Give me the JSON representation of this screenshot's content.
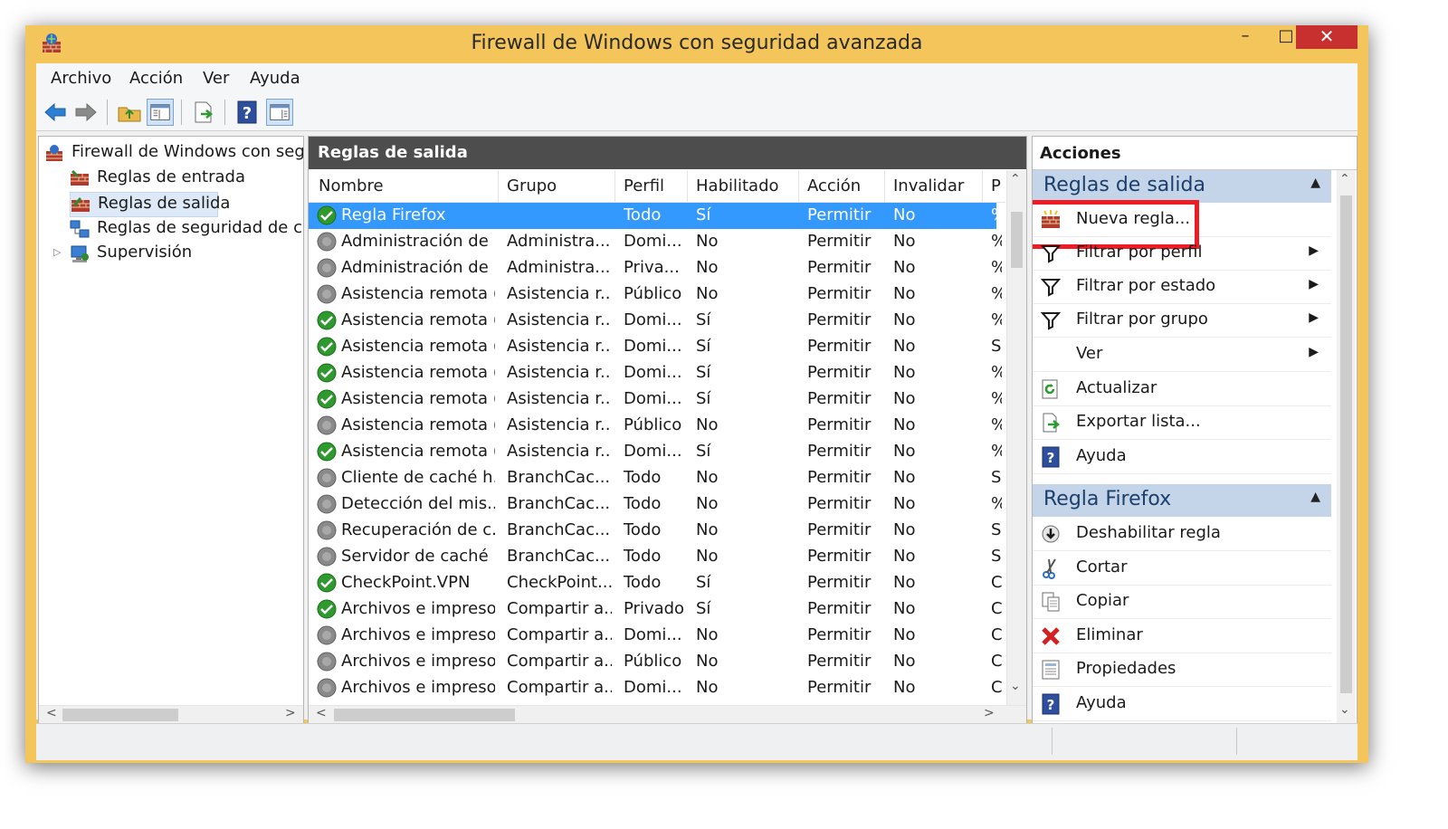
{
  "window": {
    "title": "Firewall de Windows con seguridad avanzada",
    "min": "–",
    "max": "□",
    "close": "✕"
  },
  "menu": [
    "Archivo",
    "Acción",
    "Ver",
    "Ayuda"
  ],
  "toolbar_icons": [
    "back-arrow-icon",
    "forward-arrow-icon",
    "up-folder-icon",
    "show-hide-console-tree-icon",
    "export-list-icon",
    "help-icon",
    "show-hide-action-pane-icon"
  ],
  "tree": [
    {
      "label": "Firewall de Windows con segur",
      "icon": "firewall-icon"
    },
    {
      "label": "Reglas de entrada",
      "icon": "inbound-rules-icon"
    },
    {
      "label": "Reglas de salida",
      "icon": "outbound-rules-icon",
      "selected": true
    },
    {
      "label": "Reglas de seguridad de con",
      "icon": "connection-security-icon"
    },
    {
      "label": "Supervisión",
      "icon": "monitoring-icon",
      "collapsed": true
    }
  ],
  "center": {
    "title": "Reglas de salida",
    "columns": [
      "Nombre",
      "Grupo",
      "Perfil",
      "Habilitado",
      "Acción",
      "Invalidar",
      "P"
    ],
    "rows": [
      {
        "nombre": "Regla Firefox",
        "grupo": "",
        "perfil": "Todo",
        "habilitado": "Sí",
        "accion": "Permitir",
        "invalidar": "No",
        "p": "%",
        "enabled": true,
        "selected": true
      },
      {
        "nombre": "Administración de ...",
        "grupo": "Administra...",
        "perfil": "Domi...",
        "habilitado": "No",
        "accion": "Permitir",
        "invalidar": "No",
        "p": "%",
        "enabled": false
      },
      {
        "nombre": "Administración de ...",
        "grupo": "Administra...",
        "perfil": "Priva...",
        "habilitado": "No",
        "accion": "Permitir",
        "invalidar": "No",
        "p": "%",
        "enabled": false
      },
      {
        "nombre": "Asistencia remota (...",
        "grupo": "Asistencia r...",
        "perfil": "Público",
        "habilitado": "No",
        "accion": "Permitir",
        "invalidar": "No",
        "p": "%",
        "enabled": false
      },
      {
        "nombre": "Asistencia remota (...",
        "grupo": "Asistencia r...",
        "perfil": "Domi...",
        "habilitado": "Sí",
        "accion": "Permitir",
        "invalidar": "No",
        "p": "%",
        "enabled": true
      },
      {
        "nombre": "Asistencia remota (...",
        "grupo": "Asistencia r...",
        "perfil": "Domi...",
        "habilitado": "Sí",
        "accion": "Permitir",
        "invalidar": "No",
        "p": "S",
        "enabled": true
      },
      {
        "nombre": "Asistencia remota (...",
        "grupo": "Asistencia r...",
        "perfil": "Domi...",
        "habilitado": "Sí",
        "accion": "Permitir",
        "invalidar": "No",
        "p": "%",
        "enabled": true
      },
      {
        "nombre": "Asistencia remota (...",
        "grupo": "Asistencia r...",
        "perfil": "Domi...",
        "habilitado": "Sí",
        "accion": "Permitir",
        "invalidar": "No",
        "p": "%",
        "enabled": true
      },
      {
        "nombre": "Asistencia remota (...",
        "grupo": "Asistencia r...",
        "perfil": "Público",
        "habilitado": "No",
        "accion": "Permitir",
        "invalidar": "No",
        "p": "%",
        "enabled": false
      },
      {
        "nombre": "Asistencia remota (...",
        "grupo": "Asistencia r...",
        "perfil": "Domi...",
        "habilitado": "Sí",
        "accion": "Permitir",
        "invalidar": "No",
        "p": "%",
        "enabled": true
      },
      {
        "nombre": "Cliente de caché h...",
        "grupo": "BranchCac...",
        "perfil": "Todo",
        "habilitado": "No",
        "accion": "Permitir",
        "invalidar": "No",
        "p": "S",
        "enabled": false
      },
      {
        "nombre": "Detección del mis...",
        "grupo": "BranchCac...",
        "perfil": "Todo",
        "habilitado": "No",
        "accion": "Permitir",
        "invalidar": "No",
        "p": "%",
        "enabled": false
      },
      {
        "nombre": "Recuperación de c...",
        "grupo": "BranchCac...",
        "perfil": "Todo",
        "habilitado": "No",
        "accion": "Permitir",
        "invalidar": "No",
        "p": "S",
        "enabled": false
      },
      {
        "nombre": "Servidor de caché ...",
        "grupo": "BranchCac...",
        "perfil": "Todo",
        "habilitado": "No",
        "accion": "Permitir",
        "invalidar": "No",
        "p": "S",
        "enabled": false
      },
      {
        "nombre": "CheckPoint.VPN",
        "grupo": "CheckPoint...",
        "perfil": "Todo",
        "habilitado": "Sí",
        "accion": "Permitir",
        "invalidar": "No",
        "p": "C",
        "enabled": true
      },
      {
        "nombre": "Archivos e impreso...",
        "grupo": "Compartir a...",
        "perfil": "Privado",
        "habilitado": "Sí",
        "accion": "Permitir",
        "invalidar": "No",
        "p": "C",
        "enabled": true
      },
      {
        "nombre": "Archivos e impreso...",
        "grupo": "Compartir a...",
        "perfil": "Domi...",
        "habilitado": "No",
        "accion": "Permitir",
        "invalidar": "No",
        "p": "C",
        "enabled": false
      },
      {
        "nombre": "Archivos e impreso...",
        "grupo": "Compartir a...",
        "perfil": "Público",
        "habilitado": "No",
        "accion": "Permitir",
        "invalidar": "No",
        "p": "C",
        "enabled": false
      },
      {
        "nombre": "Archivos e impreso...",
        "grupo": "Compartir a...",
        "perfil": "Domi...",
        "habilitado": "No",
        "accion": "Permitir",
        "invalidar": "No",
        "p": "C",
        "enabled": false
      }
    ]
  },
  "actions": {
    "title": "Acciones",
    "sections": [
      {
        "title": "Reglas de salida",
        "items": [
          {
            "label": "Nueva regla...",
            "icon": "new-rule-icon",
            "highlighted": true
          },
          {
            "label": "Filtrar por perfil",
            "icon": "filter-icon",
            "submenu": true
          },
          {
            "label": "Filtrar por estado",
            "icon": "filter-icon",
            "submenu": true
          },
          {
            "label": "Filtrar por grupo",
            "icon": "filter-icon",
            "submenu": true
          },
          {
            "label": "Ver",
            "icon": "",
            "submenu": true
          },
          {
            "label": "Actualizar",
            "icon": "refresh-icon"
          },
          {
            "label": "Exportar lista...",
            "icon": "export-list-icon"
          },
          {
            "label": "Ayuda",
            "icon": "help-icon"
          }
        ]
      },
      {
        "title": "Regla Firefox",
        "items": [
          {
            "label": "Deshabilitar regla",
            "icon": "disable-rule-icon"
          },
          {
            "label": "Cortar",
            "icon": "cut-icon"
          },
          {
            "label": "Copiar",
            "icon": "copy-icon"
          },
          {
            "label": "Eliminar",
            "icon": "delete-icon"
          },
          {
            "label": "Propiedades",
            "icon": "properties-icon"
          },
          {
            "label": "Ayuda",
            "icon": "help-icon"
          }
        ]
      }
    ]
  },
  "colors": {
    "titlebar": "#f3c55b",
    "selection": "#3399ff",
    "section_header": "#c4d5ea",
    "highlight_box": "#ee1c24",
    "close_button": "#c7302f",
    "enabled_icon": "#2e9a2e",
    "disabled_icon": "#8a8a8a"
  }
}
